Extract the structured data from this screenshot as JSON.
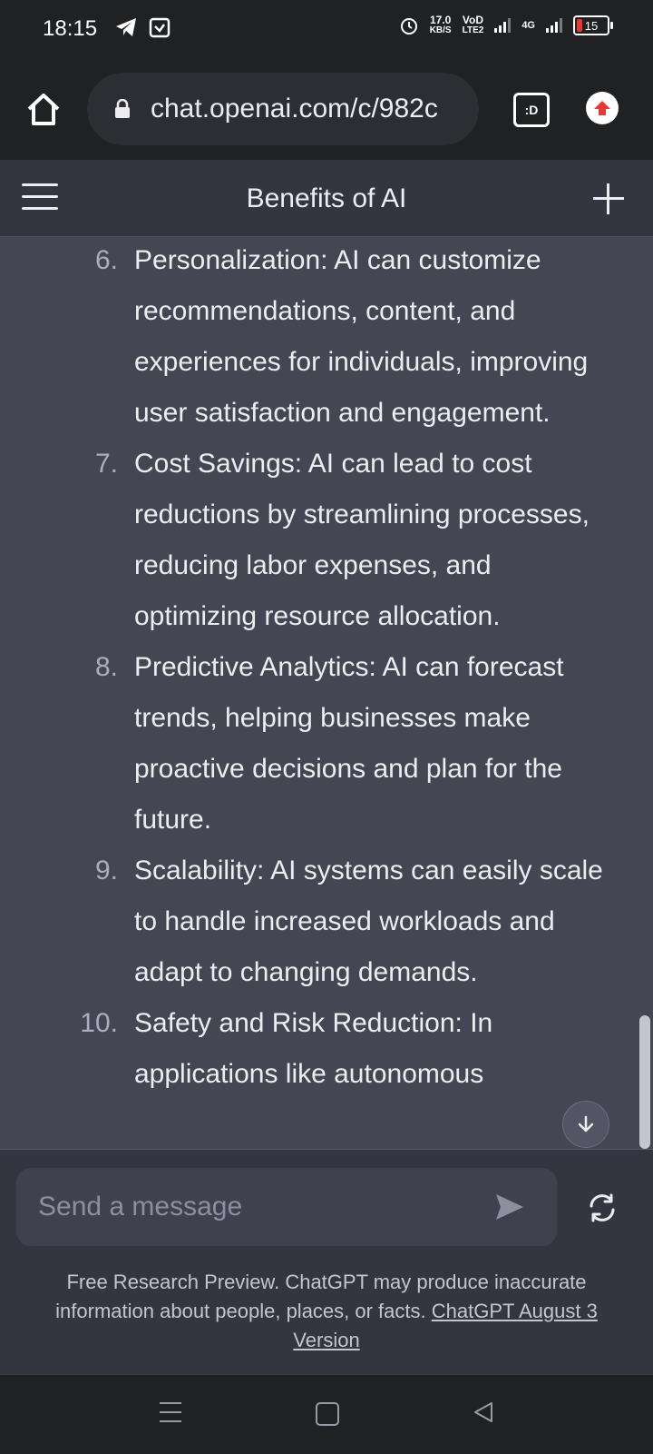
{
  "status_bar": {
    "time": "18:15",
    "network_speed": "17.0",
    "network_unit": "KB/S",
    "volte": "VoD",
    "lte": "LTE2",
    "network_type": "4G",
    "battery": "15"
  },
  "browser": {
    "url": "chat.openai.com/c/982c",
    "tab_label": ":D"
  },
  "header": {
    "title": "Benefits of AI"
  },
  "chat": {
    "items": [
      {
        "number": "6.",
        "text": "Personalization: AI can customize recommendations, content, and experiences for individuals, improving user satisfaction and engagement."
      },
      {
        "number": "7.",
        "text": "Cost Savings: AI can lead to cost reductions by streamlining processes, reducing labor expenses, and optimizing resource allocation."
      },
      {
        "number": "8.",
        "text": "Predictive Analytics: AI can forecast trends, helping businesses make proactive decisions and plan for the future."
      },
      {
        "number": "9.",
        "text": "Scalability: AI systems can easily scale to handle increased workloads and adapt to changing demands."
      },
      {
        "number": "10.",
        "text": "Safety and Risk Reduction: In applications like autonomous"
      }
    ]
  },
  "composer": {
    "placeholder": "Send a message",
    "disclaimer_text": "Free Research Preview. ChatGPT may produce inaccurate information about people, places, or facts.",
    "version_link": "ChatGPT August 3 Version"
  },
  "icons": {
    "home": "home-icon",
    "lock": "lock-icon",
    "upload": "upload-icon",
    "menu": "menu-icon",
    "plus": "plus-icon",
    "send": "send-icon",
    "regenerate": "regenerate-icon",
    "scroll_down": "arrow-down-icon"
  },
  "colors": {
    "chat_background": "#444654",
    "page_background": "#343541",
    "input_background": "#40414f",
    "upload_accent": "#e53935"
  }
}
